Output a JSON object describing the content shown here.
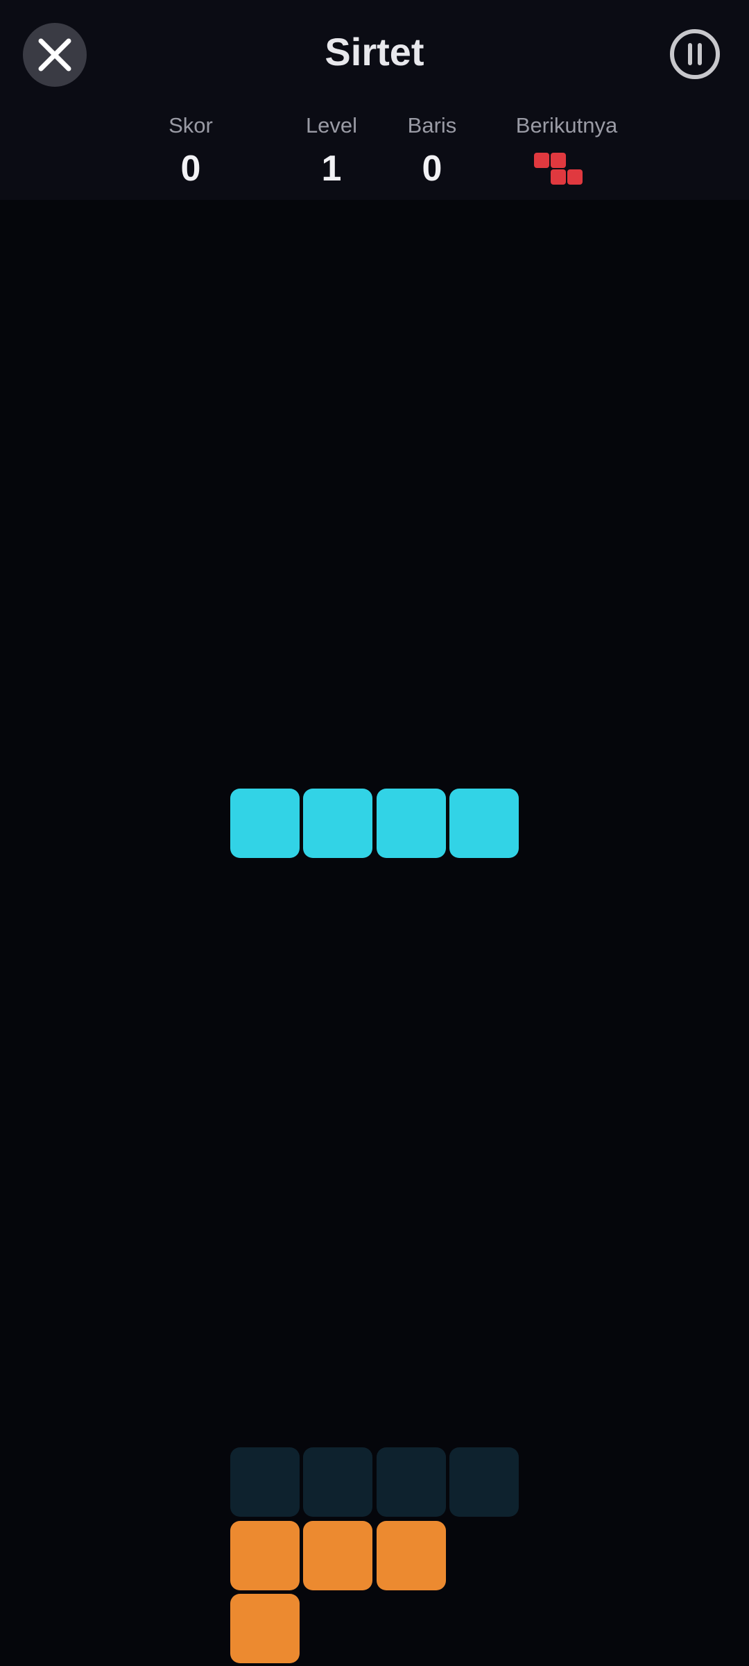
{
  "header": {
    "title": "Sirtet",
    "close_icon": "close-icon",
    "pause_icon": "pause-icon"
  },
  "stats": {
    "score": {
      "label": "Skor",
      "value": "0"
    },
    "level": {
      "label": "Level",
      "value": "1"
    },
    "lines": {
      "label": "Baris",
      "value": "0"
    },
    "next": {
      "label": "Berikutnya",
      "piece": "Z",
      "color": "#e0393f"
    }
  },
  "board": {
    "columns": 4,
    "active_piece": {
      "type": "I",
      "color": "#32d3e6"
    },
    "ghost_color": "#0e222e",
    "landed_color": "#ec8a30"
  },
  "colors": {
    "background": "#05060b",
    "header_bg": "#0b0c14",
    "text_primary": "#f2f2f5",
    "text_secondary": "#9a9ba5"
  }
}
